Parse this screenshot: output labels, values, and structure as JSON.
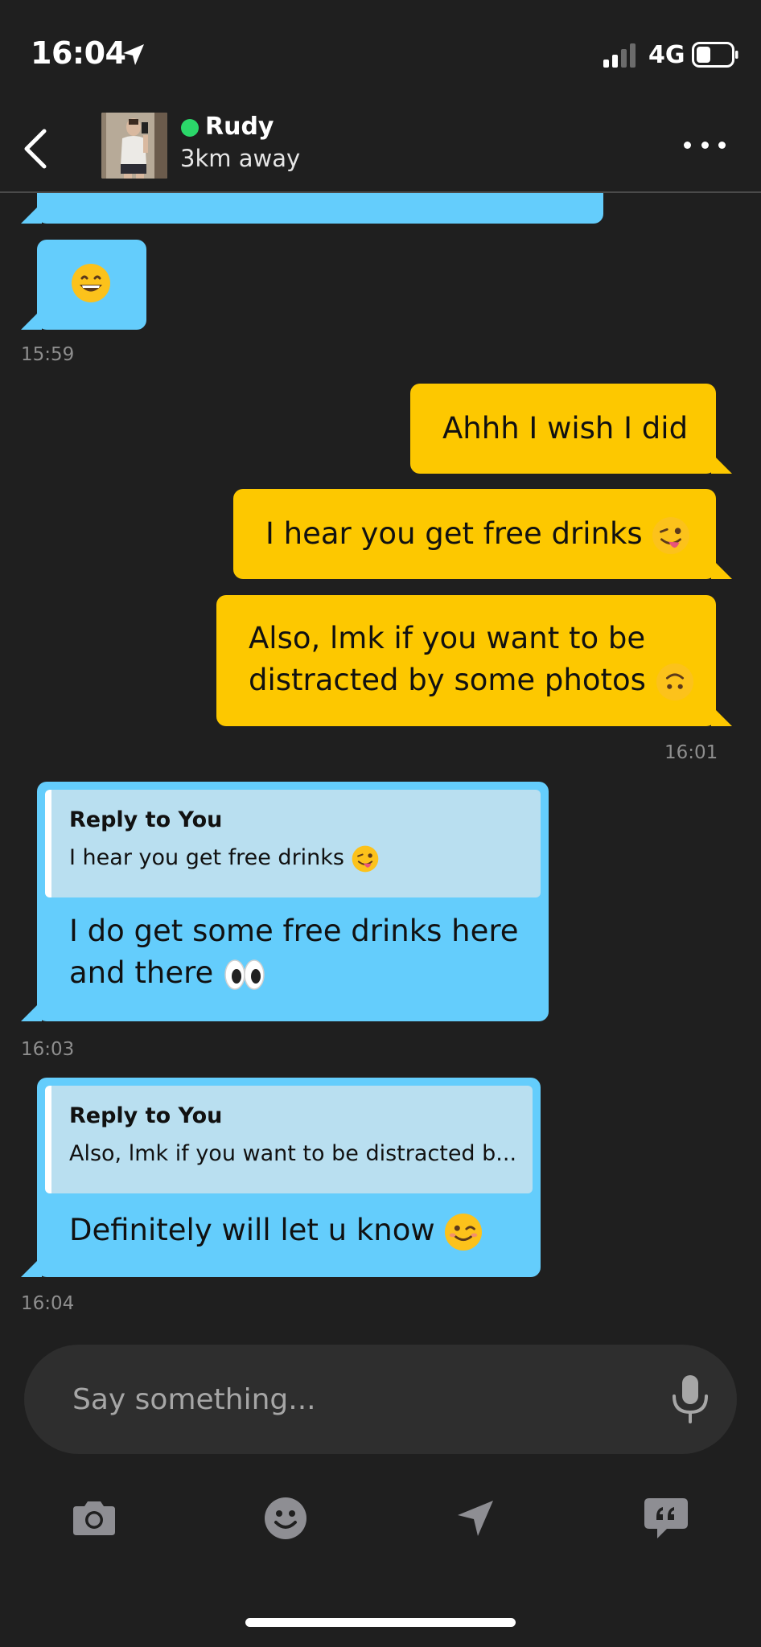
{
  "status_bar": {
    "time": "16:04",
    "network": "4G"
  },
  "header": {
    "contact_name": "Rudy",
    "distance": "3km away",
    "online": true
  },
  "messages": {
    "m1_timestamp": "15:59",
    "out1": "Ahhh I wish I did",
    "out2": "I hear you get free drinks",
    "out3_line1": "Also, lmk if you want to be",
    "out3_line2": "distracted by some photos",
    "out_timestamp": "16:01",
    "in2": {
      "reply_title": "Reply to You",
      "reply_text": "I hear you get free drinks",
      "line1": "I do get some free drinks here",
      "line2": "and there",
      "timestamp": "16:03"
    },
    "in3": {
      "reply_title": "Reply to You",
      "reply_text": "Also, lmk if you want to be distracted b...",
      "text": "Definitely will let u know",
      "timestamp": "16:04"
    }
  },
  "composer": {
    "placeholder": "Say something..."
  },
  "toolbar": [
    "camera-icon",
    "emoji-icon",
    "location-icon",
    "quick-reply-icon"
  ],
  "colors": {
    "background": "#1f1f1f",
    "incoming_bubble": "#64cdfc",
    "outgoing_bubble": "#fdc800",
    "online": "#2bd86a",
    "reply_quote": "#b9dff0"
  }
}
